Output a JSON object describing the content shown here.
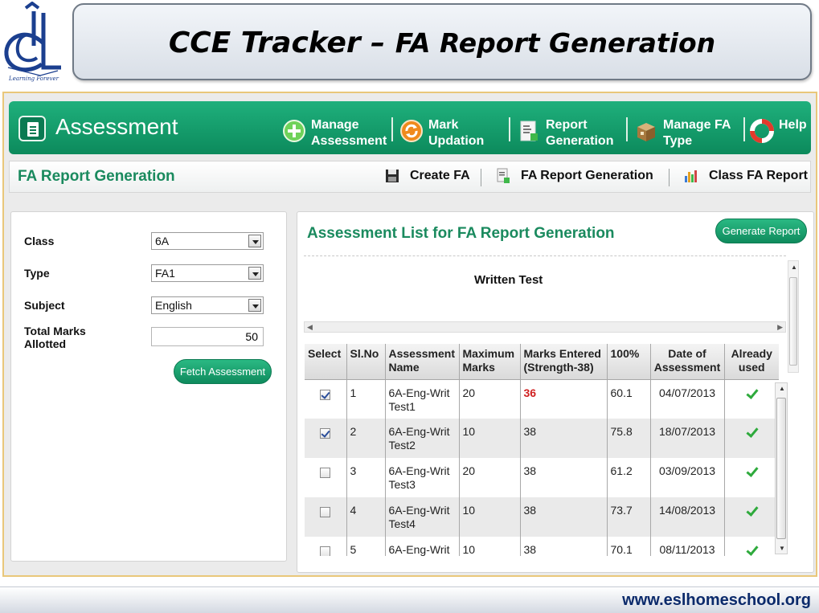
{
  "logo": {
    "tagline": "Learning Forever",
    "brand_color": "#1b3f8f"
  },
  "title": {
    "main": "CCE Tracker – ",
    "sub": "FA Report Generation"
  },
  "app": {
    "title": "Assessment",
    "accent_color": "#119165",
    "nav": [
      {
        "line1": "Manage",
        "line2": "Assessment",
        "icon": "plus-circle-icon"
      },
      {
        "line1": "Mark",
        "line2": "Updation",
        "icon": "refresh-icon"
      },
      {
        "line1": "Report",
        "line2": "Generation",
        "icon": "report-icon"
      },
      {
        "line1": "Manage FA",
        "line2": "Type",
        "icon": "box-icon"
      },
      {
        "line1": "Help",
        "line2": "",
        "icon": "lifebuoy-icon"
      }
    ]
  },
  "subbar": {
    "title": "FA Report Generation",
    "links": [
      {
        "label": "Create FA",
        "icon": "save-icon"
      },
      {
        "label": "FA Report Generation",
        "icon": "document-icon"
      },
      {
        "label": "Class FA Report",
        "icon": "bar-chart-icon"
      }
    ]
  },
  "filters": {
    "class_label": "Class",
    "class_value": "6A",
    "type_label": "Type",
    "type_value": "FA1",
    "subject_label": "Subject",
    "subject_value": "English",
    "marks_label_1": "Total Marks",
    "marks_label_2": "Allotted",
    "marks_value": "50",
    "fetch_button": "Fetch Assessment"
  },
  "list": {
    "title": "Assessment List for FA Report Generation",
    "generate_button": "Generate Report",
    "group": "Written Test",
    "columns": {
      "select": "Select",
      "slno": "Sl.No",
      "name_1": "Assessment",
      "name_2": "Name",
      "max_1": "Maximum",
      "max_2": "Marks",
      "entered_1": "Marks Entered",
      "entered_2": "(Strength-38)",
      "pct": "100%",
      "date_1": "Date of",
      "date_2": "Assessment",
      "used_1": "Already",
      "used_2": "used"
    },
    "rows": [
      {
        "selected": true,
        "slno": "1",
        "name_1": "6A-Eng-Writ",
        "name_2": "Test1",
        "max": "20",
        "entered": "36",
        "pct": "60.1",
        "date": "04/07/2013",
        "used": true
      },
      {
        "selected": true,
        "slno": "2",
        "name_1": "6A-Eng-Writ",
        "name_2": "Test2",
        "max": "10",
        "entered": "38",
        "pct": "75.8",
        "date": "18/07/2013",
        "used": true
      },
      {
        "selected": false,
        "slno": "3",
        "name_1": "6A-Eng-Writ",
        "name_2": "Test3",
        "max": "20",
        "entered": "38",
        "pct": "61.2",
        "date": "03/09/2013",
        "used": true
      },
      {
        "selected": false,
        "slno": "4",
        "name_1": "6A-Eng-Writ",
        "name_2": "Test4",
        "max": "10",
        "entered": "38",
        "pct": "73.7",
        "date": "14/08/2013",
        "used": true
      },
      {
        "selected": false,
        "slno": "5",
        "name_1": "6A-Eng-Writ",
        "name_2": "",
        "max": "10",
        "entered": "38",
        "pct": "70.1",
        "date": "08/11/2013",
        "used": true
      }
    ]
  },
  "footer": {
    "url": "www.eslhomeschool.org"
  }
}
